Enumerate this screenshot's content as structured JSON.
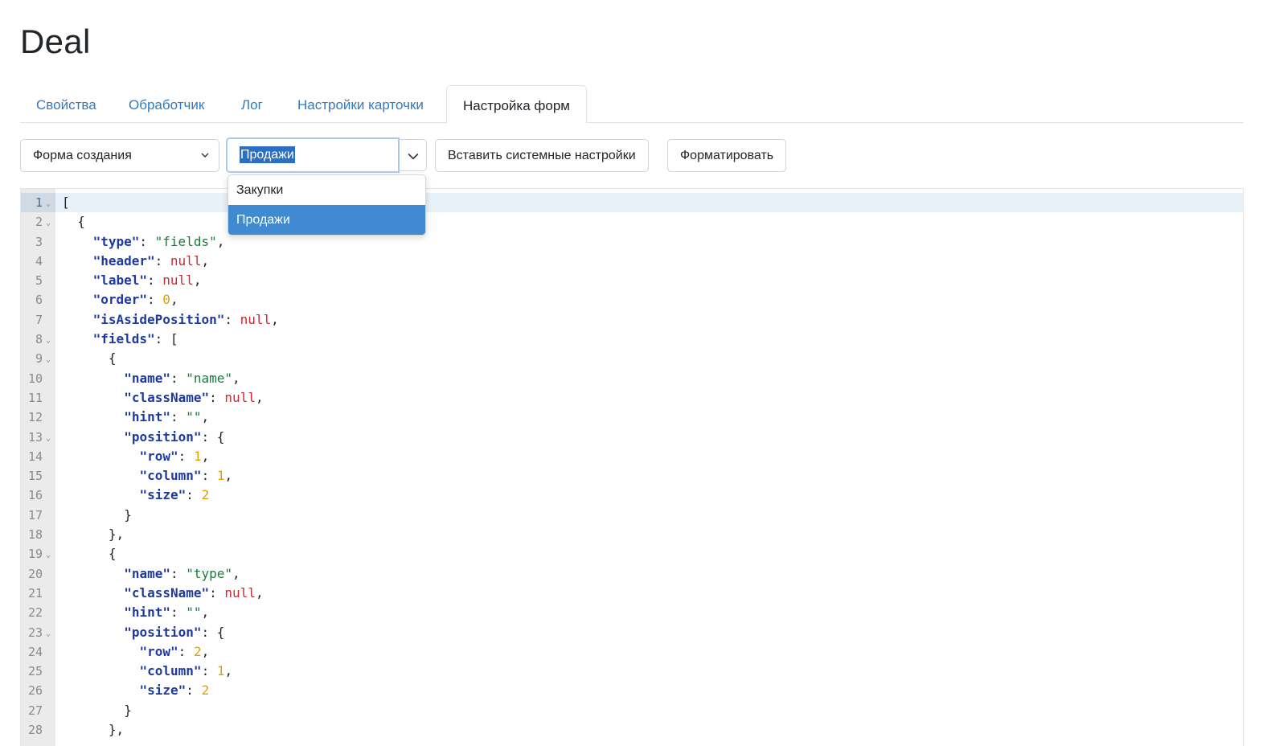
{
  "page": {
    "title": "Deal"
  },
  "tabs": [
    {
      "label": "Свойства",
      "active": false
    },
    {
      "label": "Обработчик",
      "active": false
    },
    {
      "label": "Лог",
      "active": false
    },
    {
      "label": "Настройки карточки",
      "active": false
    },
    {
      "label": "Настройка форм",
      "active": true
    }
  ],
  "toolbar": {
    "form_select_value": "Форма создания",
    "combo_value": "Продажи",
    "insert_button_label": "Вставить системные настройки",
    "format_button_label": "Форматировать"
  },
  "dropdown": {
    "options": [
      {
        "label": "Закупки",
        "selected": false
      },
      {
        "label": "Продажи",
        "selected": true
      }
    ]
  },
  "editor": {
    "active_line": 1,
    "lines": [
      {
        "n": "1",
        "fold": true,
        "indent": 0,
        "tokens": [
          [
            "p",
            "["
          ]
        ]
      },
      {
        "n": "2",
        "fold": true,
        "indent": 1,
        "tokens": [
          [
            "p",
            "{"
          ]
        ]
      },
      {
        "n": "3",
        "fold": false,
        "indent": 2,
        "tokens": [
          [
            "k",
            "\"type\""
          ],
          [
            "p",
            ": "
          ],
          [
            "s",
            "\"fields\""
          ],
          [
            "p",
            ","
          ]
        ]
      },
      {
        "n": "4",
        "fold": false,
        "indent": 2,
        "tokens": [
          [
            "k",
            "\"header\""
          ],
          [
            "p",
            ": "
          ],
          [
            "n",
            "null"
          ],
          [
            "p",
            ","
          ]
        ]
      },
      {
        "n": "5",
        "fold": false,
        "indent": 2,
        "tokens": [
          [
            "k",
            "\"label\""
          ],
          [
            "p",
            ": "
          ],
          [
            "n",
            "null"
          ],
          [
            "p",
            ","
          ]
        ]
      },
      {
        "n": "6",
        "fold": false,
        "indent": 2,
        "tokens": [
          [
            "k",
            "\"order\""
          ],
          [
            "p",
            ": "
          ],
          [
            "num",
            "0"
          ],
          [
            "p",
            ","
          ]
        ]
      },
      {
        "n": "7",
        "fold": false,
        "indent": 2,
        "tokens": [
          [
            "k",
            "\"isAsidePosition\""
          ],
          [
            "p",
            ": "
          ],
          [
            "n",
            "null"
          ],
          [
            "p",
            ","
          ]
        ]
      },
      {
        "n": "8",
        "fold": true,
        "indent": 2,
        "tokens": [
          [
            "k",
            "\"fields\""
          ],
          [
            "p",
            ": ["
          ]
        ]
      },
      {
        "n": "9",
        "fold": true,
        "indent": 3,
        "tokens": [
          [
            "p",
            "{"
          ]
        ]
      },
      {
        "n": "10",
        "fold": false,
        "indent": 4,
        "tokens": [
          [
            "k",
            "\"name\""
          ],
          [
            "p",
            ": "
          ],
          [
            "s",
            "\"name\""
          ],
          [
            "p",
            ","
          ]
        ]
      },
      {
        "n": "11",
        "fold": false,
        "indent": 4,
        "tokens": [
          [
            "k",
            "\"className\""
          ],
          [
            "p",
            ": "
          ],
          [
            "n",
            "null"
          ],
          [
            "p",
            ","
          ]
        ]
      },
      {
        "n": "12",
        "fold": false,
        "indent": 4,
        "tokens": [
          [
            "k",
            "\"hint\""
          ],
          [
            "p",
            ": "
          ],
          [
            "s",
            "\"\""
          ],
          [
            "p",
            ","
          ]
        ]
      },
      {
        "n": "13",
        "fold": true,
        "indent": 4,
        "tokens": [
          [
            "k",
            "\"position\""
          ],
          [
            "p",
            ": {"
          ]
        ]
      },
      {
        "n": "14",
        "fold": false,
        "indent": 5,
        "tokens": [
          [
            "k",
            "\"row\""
          ],
          [
            "p",
            ": "
          ],
          [
            "num",
            "1"
          ],
          [
            "p",
            ","
          ]
        ]
      },
      {
        "n": "15",
        "fold": false,
        "indent": 5,
        "tokens": [
          [
            "k",
            "\"column\""
          ],
          [
            "p",
            ": "
          ],
          [
            "num",
            "1"
          ],
          [
            "p",
            ","
          ]
        ]
      },
      {
        "n": "16",
        "fold": false,
        "indent": 5,
        "tokens": [
          [
            "k",
            "\"size\""
          ],
          [
            "p",
            ": "
          ],
          [
            "num",
            "2"
          ]
        ]
      },
      {
        "n": "17",
        "fold": false,
        "indent": 4,
        "tokens": [
          [
            "p",
            "}"
          ]
        ]
      },
      {
        "n": "18",
        "fold": false,
        "indent": 3,
        "tokens": [
          [
            "p",
            "},"
          ]
        ]
      },
      {
        "n": "19",
        "fold": true,
        "indent": 3,
        "tokens": [
          [
            "p",
            "{"
          ]
        ]
      },
      {
        "n": "20",
        "fold": false,
        "indent": 4,
        "tokens": [
          [
            "k",
            "\"name\""
          ],
          [
            "p",
            ": "
          ],
          [
            "s",
            "\"type\""
          ],
          [
            "p",
            ","
          ]
        ]
      },
      {
        "n": "21",
        "fold": false,
        "indent": 4,
        "tokens": [
          [
            "k",
            "\"className\""
          ],
          [
            "p",
            ": "
          ],
          [
            "n",
            "null"
          ],
          [
            "p",
            ","
          ]
        ]
      },
      {
        "n": "22",
        "fold": false,
        "indent": 4,
        "tokens": [
          [
            "k",
            "\"hint\""
          ],
          [
            "p",
            ": "
          ],
          [
            "s",
            "\"\""
          ],
          [
            "p",
            ","
          ]
        ]
      },
      {
        "n": "23",
        "fold": true,
        "indent": 4,
        "tokens": [
          [
            "k",
            "\"position\""
          ],
          [
            "p",
            ": {"
          ]
        ]
      },
      {
        "n": "24",
        "fold": false,
        "indent": 5,
        "tokens": [
          [
            "k",
            "\"row\""
          ],
          [
            "p",
            ": "
          ],
          [
            "num",
            "2"
          ],
          [
            "p",
            ","
          ]
        ]
      },
      {
        "n": "25",
        "fold": false,
        "indent": 5,
        "tokens": [
          [
            "k",
            "\"column\""
          ],
          [
            "p",
            ": "
          ],
          [
            "num",
            "1"
          ],
          [
            "p",
            ","
          ]
        ]
      },
      {
        "n": "26",
        "fold": false,
        "indent": 5,
        "tokens": [
          [
            "k",
            "\"size\""
          ],
          [
            "p",
            ": "
          ],
          [
            "num",
            "2"
          ]
        ]
      },
      {
        "n": "27",
        "fold": false,
        "indent": 4,
        "tokens": [
          [
            "p",
            "}"
          ]
        ]
      },
      {
        "n": "28",
        "fold": false,
        "indent": 3,
        "tokens": [
          [
            "p",
            "},"
          ]
        ]
      }
    ]
  }
}
